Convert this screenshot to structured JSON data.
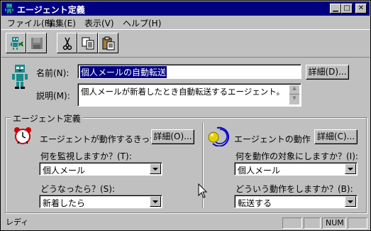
{
  "window": {
    "title": "エージェント定義"
  },
  "menu": [
    {
      "label": "ファイル(F)"
    },
    {
      "label": "編集(E)"
    },
    {
      "label": "表示(V)"
    },
    {
      "label": "ヘルプ(H)"
    }
  ],
  "toolbar": {
    "buttons": [
      {
        "icon": "new-agent-icon"
      },
      {
        "icon": "save-icon"
      },
      {
        "icon": "cut-icon"
      },
      {
        "icon": "copy-icon"
      },
      {
        "icon": "paste-icon"
      }
    ]
  },
  "agent": {
    "name_label": "名前(N):",
    "name_value": "個人メールの自動転送",
    "detail_button": "詳細(D)...",
    "desc_label": "説明(M):",
    "desc_value": "個人メールが新着したとき自動転送するエージェント。"
  },
  "definition": {
    "group_label": "エージェント定義",
    "trigger": {
      "title": "エージェントが動作するきっかけ",
      "detail_button": "詳細(O)...",
      "watch_label": "何を監視しますか？(T):",
      "watch_value": "個人メール",
      "when_label": "どうなったら？(S):",
      "when_value": "新着したら"
    },
    "action": {
      "title": "エージェントの動作",
      "detail_button": "詳細(C)...",
      "target_label": "何を動作の対象にしますか？(I):",
      "target_value": "個人メール",
      "do_label": "どういう動作をしますか？(B):",
      "do_value": "転送する"
    }
  },
  "status": {
    "text": "レディ",
    "num": "NUM"
  },
  "colors": {
    "titlebar": "#000080",
    "face": "#c0c0c0"
  }
}
